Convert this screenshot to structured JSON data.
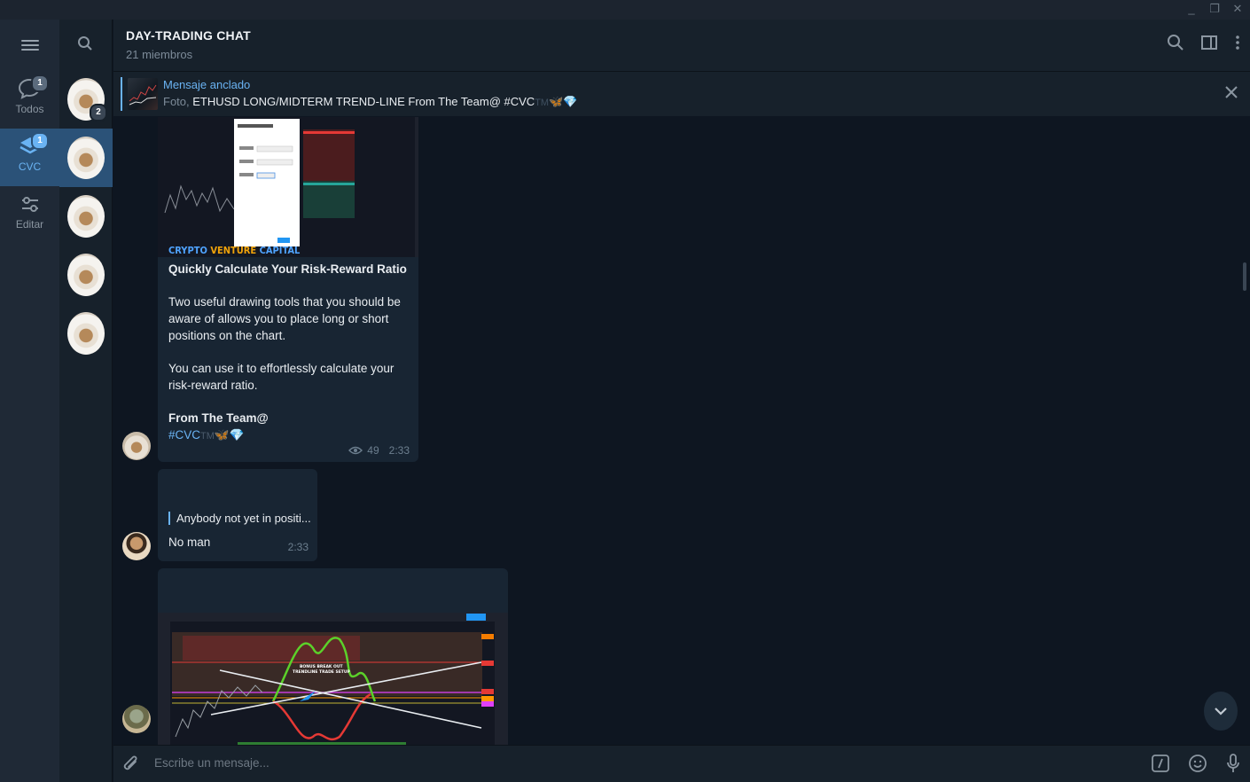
{
  "window": {
    "controls": [
      "_",
      "❐",
      "✕"
    ]
  },
  "nav": {
    "menu_icon": "hamburger-icon",
    "folders": [
      {
        "label": "Todos",
        "badge": "1",
        "icon": "chats-icon",
        "active": false
      },
      {
        "label": "CVC",
        "badge": "1",
        "icon": "folder-stack-icon",
        "active": true
      },
      {
        "label": "Editar",
        "badge": "",
        "icon": "sliders-icon",
        "active": false
      }
    ]
  },
  "chatlist": {
    "search_icon": "search-icon",
    "items": [
      {
        "badge": "2",
        "active": false
      },
      {
        "badge": "",
        "active": true
      },
      {
        "badge": "",
        "active": false
      },
      {
        "badge": "",
        "active": false
      },
      {
        "badge": "",
        "active": false
      }
    ]
  },
  "header": {
    "title": "DAY-TRADING CHAT",
    "subtitle": "21 miembros"
  },
  "pinned": {
    "title": "Mensaje anclado",
    "prefix": "Foto, ",
    "text": "ETHUSD  LONG/MIDTERM TREND-LINE  From The Team@ #CVC",
    "tm": "TM",
    "emoji": "🦋💎"
  },
  "messages": {
    "m1": {
      "media_brand": "CRYPTO VENTURE CAPITAL",
      "title": "Quickly Calculate Your Risk-Reward Ratio",
      "para1": "Two useful drawing tools that you should be aware of allows you to place long or short positions on the chart.",
      "para2": "You can use it to effortlessly calculate your risk-reward ratio.",
      "from": "From The Team@",
      "tag": "#CVC",
      "tm": "TM",
      "emoji": "🦋💎",
      "views": "49",
      "time": "2:33"
    },
    "m2": {
      "reply": "Anybody not yet in positi...",
      "text": "No man",
      "time": "2:33"
    },
    "m3": {
      "chart_label": "BONUS BREAK OUT TRENDLINE TRADE SETUP"
    }
  },
  "composer": {
    "placeholder": "Escribe un mensaje...",
    "attach_icon": "paperclip-icon",
    "commands_icon": "slash-command-icon",
    "emoji_icon": "smiley-icon",
    "mic_icon": "microphone-icon"
  },
  "colors": {
    "accent": "#6ab3f3",
    "active_bg": "#2b5278",
    "bubble": "#182533",
    "background": "#0e1621"
  }
}
